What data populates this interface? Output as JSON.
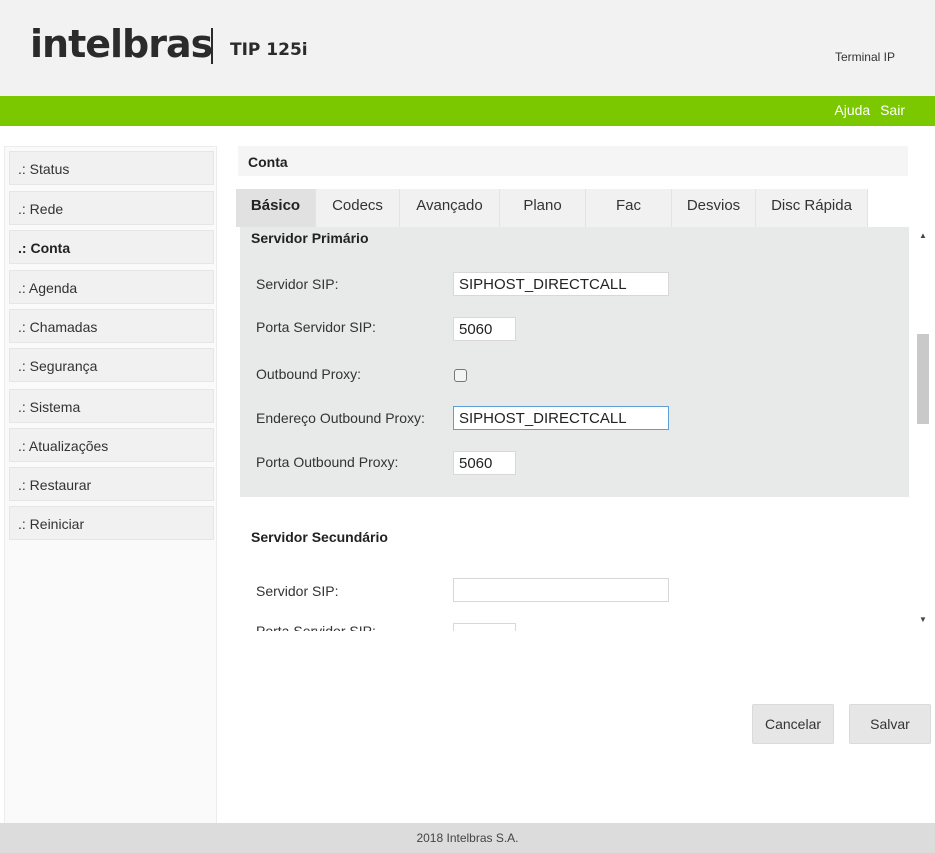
{
  "header": {
    "brand": "intelbras",
    "model": "TIP 125i",
    "product_type": "Terminal IP"
  },
  "top_links": {
    "help": "Ajuda",
    "logout": "Sair"
  },
  "sidebar": {
    "items": [
      {
        "prefix": ".:",
        "label": "Status"
      },
      {
        "prefix": ".:",
        "label": "Rede"
      },
      {
        "prefix": ".:",
        "label": "Conta"
      },
      {
        "prefix": ".:",
        "label": "Agenda"
      },
      {
        "prefix": ".:",
        "label": "Chamadas"
      },
      {
        "prefix": ".:",
        "label": "Segurança"
      },
      {
        "prefix": ".:",
        "label": "Sistema"
      },
      {
        "prefix": ".:",
        "label": "Atualizações"
      },
      {
        "prefix": ".:",
        "label": "Restaurar"
      },
      {
        "prefix": ".:",
        "label": "Reiniciar"
      }
    ],
    "active": "Conta"
  },
  "main": {
    "title": "Conta",
    "tabs": [
      "Básico",
      "Codecs",
      "Avançado",
      "Plano",
      "Fac",
      "Desvios",
      "Disc Rápida"
    ],
    "active_tab": "Básico",
    "primary": {
      "title": "Servidor Primário",
      "sip_server_label": "Servidor SIP:",
      "sip_server_value": "SIPHOST_DIRECTCALL",
      "sip_port_label": "Porta Servidor SIP:",
      "sip_port_value": "5060",
      "outbound_proxy_label": "Outbound Proxy:",
      "outbound_proxy_checked": false,
      "outbound_address_label": "Endereço Outbound Proxy:",
      "outbound_address_value": "SIPHOST_DIRECTCALL",
      "outbound_port_label": "Porta Outbound Proxy:",
      "outbound_port_value": "5060"
    },
    "secondary": {
      "title": "Servidor Secundário",
      "sip_server_label": "Servidor SIP:",
      "sip_server_value": "",
      "sip_port_label": "Porta Servidor SIP:"
    },
    "buttons": {
      "cancel": "Cancelar",
      "save": "Salvar"
    }
  },
  "footer": {
    "copyright": "2018 Intelbras S.A."
  },
  "colors": {
    "accent_green": "#7bc800",
    "header_bg": "#f2f2f2",
    "panel_bg": "#e8e9e9"
  }
}
